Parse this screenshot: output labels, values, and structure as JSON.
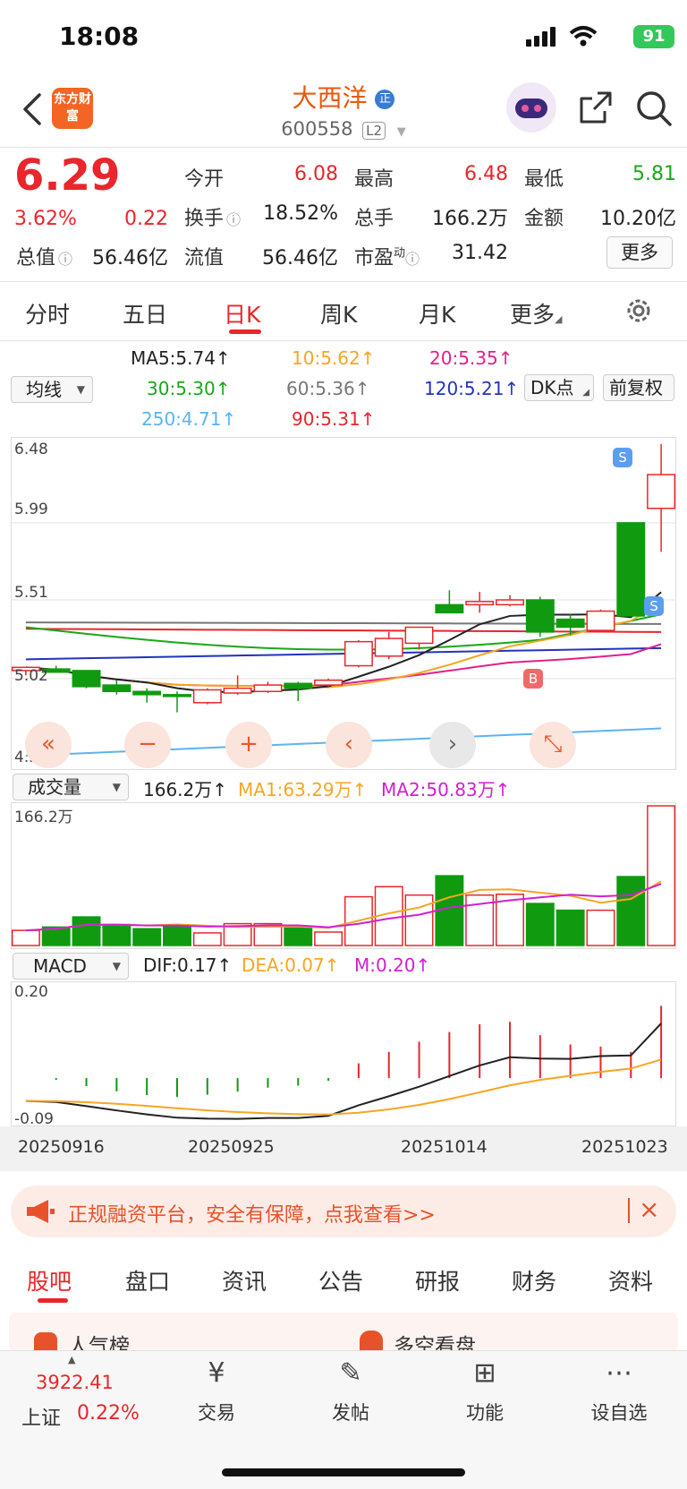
{
  "status": {
    "time": "18:08",
    "battery": "91"
  },
  "header": {
    "logo": "东方财富",
    "stock_name": "大西洋",
    "name_badge": "正",
    "code": "600558",
    "level": "L2"
  },
  "quote": {
    "price": "6.29",
    "change_pct": "3.62%",
    "change": "0.22",
    "open_label": "今开",
    "open": "6.08",
    "high_label": "最高",
    "high": "6.48",
    "low_label": "最低",
    "low": "5.81",
    "turnover_label": "换手",
    "turnover": "18.52%",
    "volume_label": "总手",
    "volume": "166.2万",
    "amount_label": "金额",
    "amount": "10.20亿",
    "total_value_label": "总值",
    "total_value": "56.46亿",
    "float_value_label": "流值",
    "float_value": "56.46亿",
    "pe_label": "市盈",
    "pe_sup": "动",
    "pe": "31.42",
    "more": "更多"
  },
  "tabs": [
    "分时",
    "五日",
    "日K",
    "周K",
    "月K",
    "更多"
  ],
  "ma_legend": {
    "select": "均线",
    "ma5": "MA5:5.74↑",
    "ma10": "10:5.62↑",
    "ma20": "20:5.35↑",
    "ma30": "30:5.30↑",
    "ma60": "60:5.36↑",
    "ma120": "120:5.21↑",
    "ma250": "250:4.71↑",
    "ma90": "90:5.31↑",
    "dk": "DK点",
    "adjust": "前复权",
    "colors": {
      "ma5": "#222222",
      "ma10": "#f5a623",
      "ma20": "#e0218a",
      "ma30": "#18a818",
      "ma60": "#777777",
      "ma120": "#2233bb",
      "ma250": "#5ab4f0",
      "ma90": "#e8262b"
    }
  },
  "price_axis": {
    "top": "6.48",
    "l2": "5.99",
    "l3": "5.51",
    "l4": "5.02",
    "bottom": "4.54"
  },
  "markers": {
    "sell": "S",
    "buy": "B"
  },
  "volume_legend": {
    "select": "成交量",
    "vol": "166.2万↑",
    "ma1": "MA1:63.29万↑",
    "ma2": "MA2:50.83万↑",
    "axis_top": "166.2万"
  },
  "macd_legend": {
    "select": "MACD",
    "dif": "DIF:0.17↑",
    "dea": "DEA:0.07↑",
    "m": "M:0.20↑",
    "axis_top": "0.20",
    "axis_bottom": "-0.09"
  },
  "dates": [
    "20250916",
    "20250925",
    "20251014",
    "20251023"
  ],
  "banner": "正规融资平台，安全有保障，点我查看>>",
  "bottom_tabs": [
    "股吧",
    "盘口",
    "资讯",
    "公告",
    "研报",
    "财务",
    "资料"
  ],
  "peek": {
    "left": "人气榜",
    "right": "多空看盘"
  },
  "bottom_nav": {
    "index_value": "3922.41",
    "index_name": "上证",
    "index_change": "0.22%",
    "trade": "交易",
    "post": "发帖",
    "func": "功能",
    "watch": "设自选"
  },
  "chart_data": {
    "type": "candlestick",
    "ylim": [
      4.54,
      6.48
    ],
    "candles": [
      {
        "o": 5.07,
        "h": 5.09,
        "l": 5.04,
        "c": 5.09,
        "v": 18
      },
      {
        "o": 5.08,
        "h": 5.1,
        "l": 5.06,
        "c": 5.06,
        "v": 22
      },
      {
        "o": 5.07,
        "h": 5.07,
        "l": 4.96,
        "c": 4.97,
        "v": 34
      },
      {
        "o": 4.98,
        "h": 5.01,
        "l": 4.92,
        "c": 4.94,
        "v": 25
      },
      {
        "o": 4.94,
        "h": 4.96,
        "l": 4.87,
        "c": 4.92,
        "v": 20
      },
      {
        "o": 4.92,
        "h": 4.94,
        "l": 4.81,
        "c": 4.91,
        "v": 24
      },
      {
        "o": 4.87,
        "h": 4.96,
        "l": 4.86,
        "c": 4.95,
        "v": 15
      },
      {
        "o": 4.93,
        "h": 5.04,
        "l": 4.92,
        "c": 4.96,
        "v": 26
      },
      {
        "o": 4.94,
        "h": 5.0,
        "l": 4.93,
        "c": 4.98,
        "v": 26
      },
      {
        "o": 4.99,
        "h": 5.0,
        "l": 4.88,
        "c": 4.96,
        "v": 22
      },
      {
        "o": 4.98,
        "h": 5.02,
        "l": 4.97,
        "c": 5.01,
        "v": 16
      },
      {
        "o": 5.1,
        "h": 5.26,
        "l": 5.09,
        "c": 5.25,
        "v": 58
      },
      {
        "o": 5.16,
        "h": 5.31,
        "l": 5.14,
        "c": 5.27,
        "v": 70
      },
      {
        "o": 5.24,
        "h": 5.34,
        "l": 5.2,
        "c": 5.34,
        "v": 60
      },
      {
        "o": 5.48,
        "h": 5.57,
        "l": 5.43,
        "c": 5.43,
        "v": 83
      },
      {
        "o": 5.48,
        "h": 5.56,
        "l": 5.43,
        "c": 5.5,
        "v": 60
      },
      {
        "o": 5.48,
        "h": 5.54,
        "l": 5.47,
        "c": 5.51,
        "v": 61
      },
      {
        "o": 5.51,
        "h": 5.53,
        "l": 5.28,
        "c": 5.31,
        "v": 50
      },
      {
        "o": 5.39,
        "h": 5.42,
        "l": 5.29,
        "c": 5.34,
        "v": 42
      },
      {
        "o": 5.32,
        "h": 5.45,
        "l": 5.32,
        "c": 5.44,
        "v": 42
      },
      {
        "o": 5.99,
        "h": 5.99,
        "l": 5.42,
        "c": 5.41,
        "v": 82
      },
      {
        "o": 6.08,
        "h": 6.48,
        "l": 5.81,
        "c": 6.29,
        "v": 166.2
      }
    ],
    "volume_ylim": [
      0,
      166.2
    ],
    "macd_ylim": [
      -0.09,
      0.2
    ]
  }
}
